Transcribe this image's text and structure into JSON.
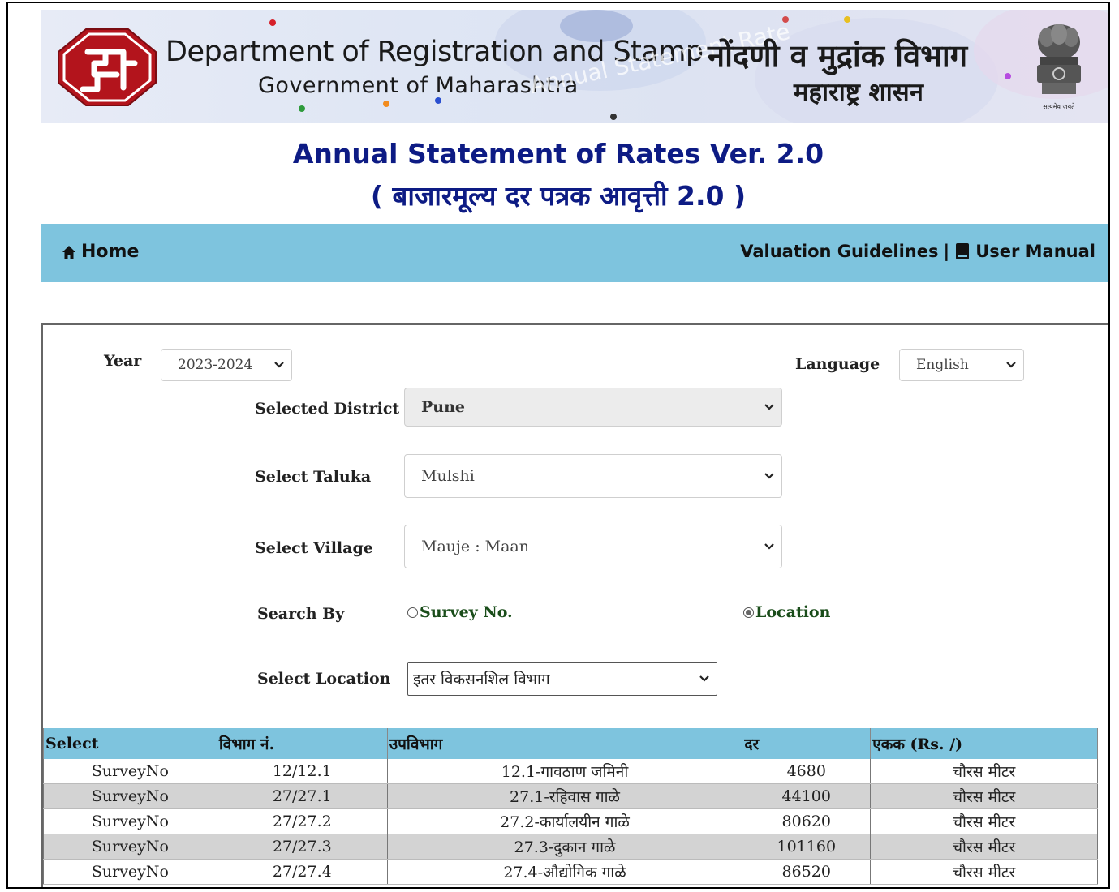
{
  "header": {
    "dept_en": "Department of Registration and Stamp",
    "gov_en": "Government of Maharashtra",
    "dept_mr": "नोंदणी व मुद्रांक विभाग",
    "gov_mr": "महाराष्ट्र शासन",
    "watermark": "Annual Statement Rate",
    "emblem_caption": "सत्यमेव जयते"
  },
  "title": {
    "line1": "Annual Statement of Rates Ver. 2.0",
    "line2": "( बाजारमूल्य दर पत्रक आवृत्ती 2.0 )"
  },
  "nav": {
    "home": "Home",
    "valuation": "Valuation Guidelines",
    "separator": "|",
    "manual": "User Manual"
  },
  "form": {
    "year_label": "Year",
    "year_value": "2023-2024",
    "language_label": "Language",
    "language_value": "English",
    "district_label": "Selected District",
    "district_value": "Pune",
    "taluka_label": "Select Taluka",
    "taluka_value": "Mulshi",
    "village_label": "Select Village",
    "village_value": "Mauje : Maan",
    "search_label": "Search By",
    "search_option1": "Survey No.",
    "search_option2": "Location",
    "search_selected": "Location",
    "location_label": "Select Location",
    "location_value": "इतर विकसनशिल विभाग"
  },
  "table": {
    "headers": [
      "Select",
      "विभाग नं.",
      "उपविभाग",
      "दर",
      "एकक (Rs. /)"
    ],
    "rows": [
      [
        "SurveyNo",
        "12/12.1",
        "12.1-गावठाण जमिनी",
        "4680",
        "चौरस मीटर"
      ],
      [
        "SurveyNo",
        "27/27.1",
        "27.1-रहिवास गाळे",
        "44100",
        "चौरस मीटर"
      ],
      [
        "SurveyNo",
        "27/27.2",
        "27.2-कार्यालयीन गाळे",
        "80620",
        "चौरस मीटर"
      ],
      [
        "SurveyNo",
        "27/27.3",
        "27.3-दुकान गाळे",
        "101160",
        "चौरस मीटर"
      ],
      [
        "SurveyNo",
        "27/27.4",
        "27.4-औद्योगिक गाळे",
        "86520",
        "चौरस मीटर"
      ]
    ]
  },
  "colors": {
    "title": "#0d1b84",
    "nav_bg": "#7ec4de",
    "logo_red": "#b3141c"
  }
}
